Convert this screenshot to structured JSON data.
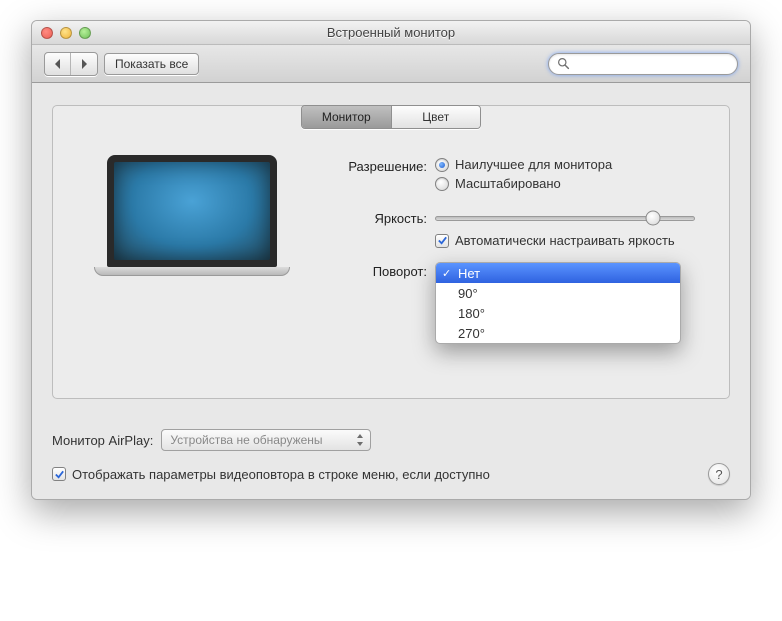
{
  "window": {
    "title": "Встроенный монитор"
  },
  "toolbar": {
    "show_all": "Показать все",
    "search_placeholder": ""
  },
  "tabs": {
    "monitor": "Монитор",
    "color": "Цвет"
  },
  "settings": {
    "resolution_label": "Разрешение:",
    "resolution_best": "Наилучшее для монитора",
    "resolution_scaled": "Масштабировано",
    "brightness_label": "Яркость:",
    "auto_brightness": "Автоматически настраивать яркость",
    "rotation_label": "Поворот:",
    "rotation_options": {
      "none": "Нет",
      "r90": "90°",
      "r180": "180°",
      "r270": "270°"
    }
  },
  "airplay": {
    "label": "Монитор AirPlay:",
    "value": "Устройства не обнаружены"
  },
  "footer": {
    "show_mirroring": "Отображать параметры видеоповтора в строке меню, если доступно",
    "help": "?"
  }
}
